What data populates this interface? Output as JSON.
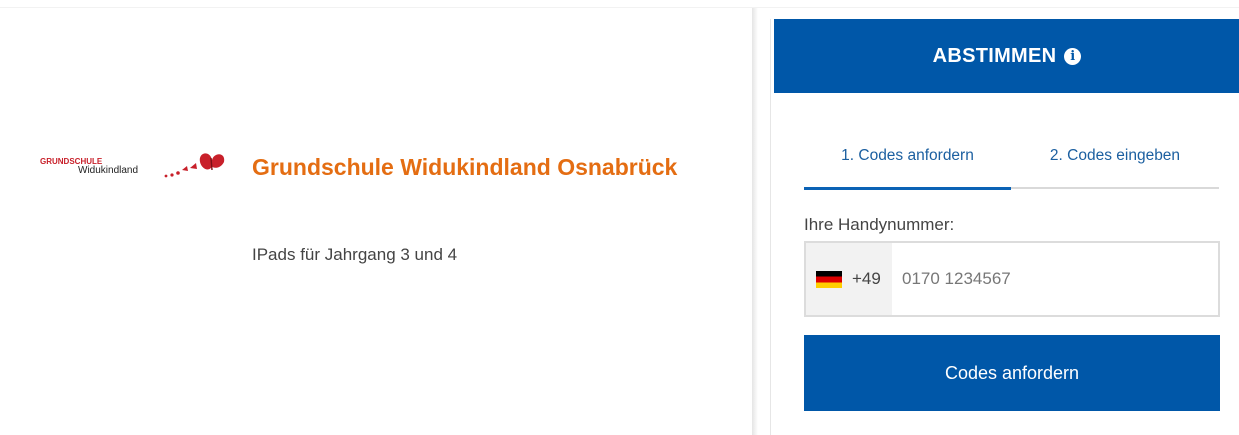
{
  "project": {
    "logo": {
      "text_top": "GRUNDSCHULE",
      "text_bottom": "Widukindland",
      "accent_color": "#c8202a"
    },
    "title": "Grundschule Widukindland Osnabrück",
    "subtitle": "IPads für Jahrgang 3 und 4",
    "title_color": "#e46d12"
  },
  "vote": {
    "header": "ABSTIMMEN",
    "header_icon": "info-icon",
    "tabs": [
      {
        "label": "1. Codes anfordern",
        "active": true
      },
      {
        "label": "2. Codes eingeben",
        "active": false
      }
    ],
    "phone_label": "Ihre Handynummer:",
    "country_flag": "flag-de-icon",
    "country_code": "+49",
    "phone_placeholder": "0170 1234567",
    "phone_value": "",
    "submit_label": "Codes anfordern",
    "brand_color": "#0057a8"
  }
}
